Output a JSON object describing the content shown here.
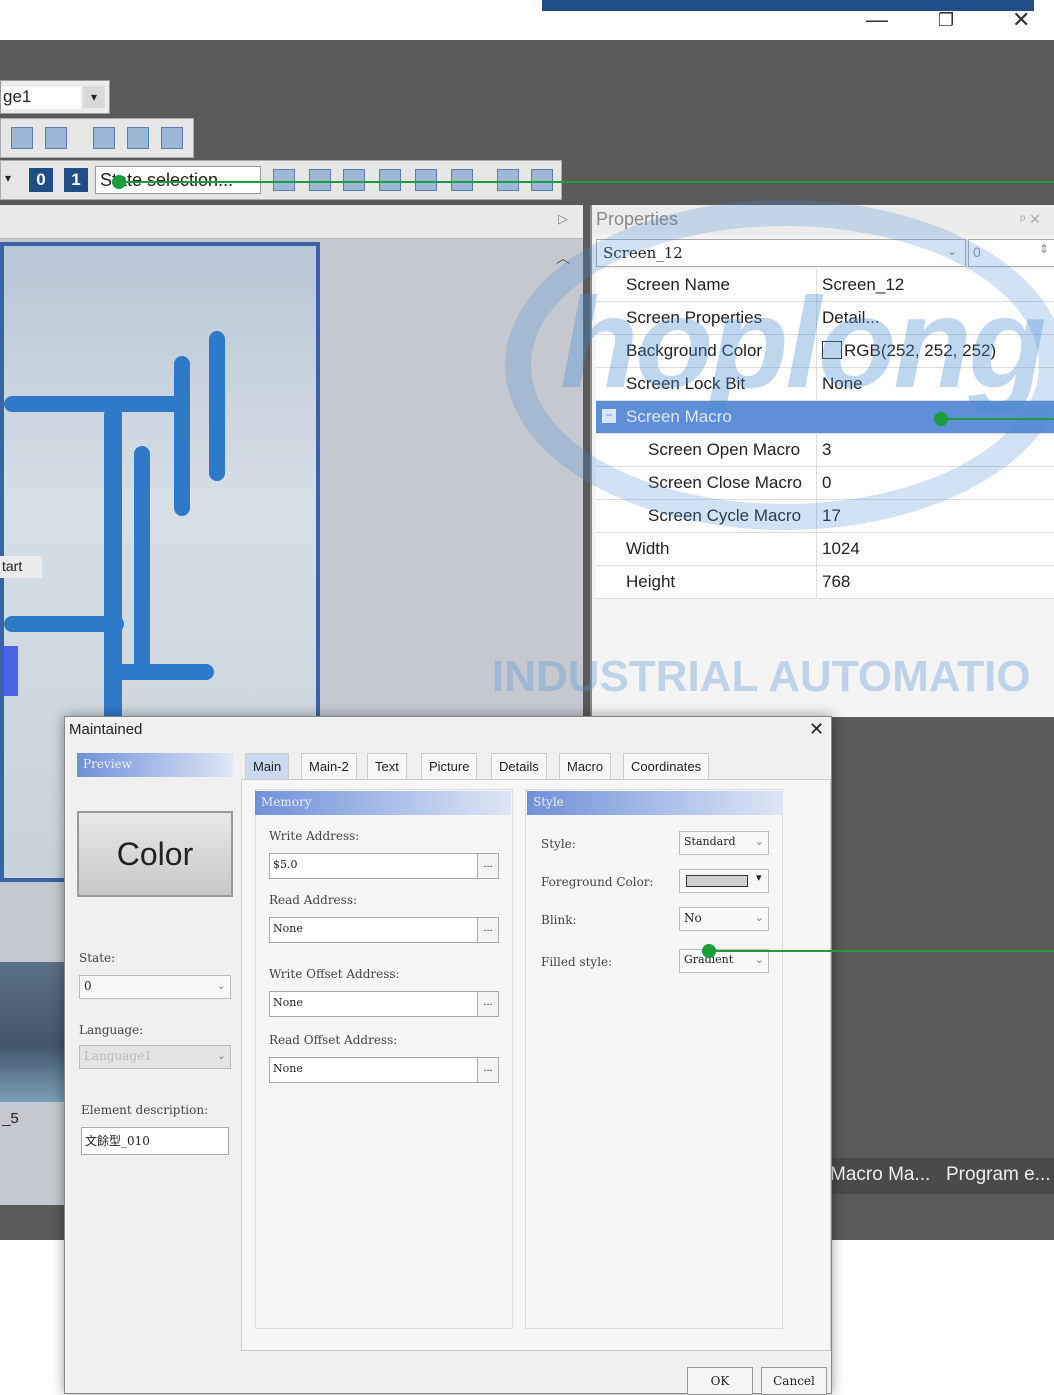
{
  "window": {
    "minimize": "—",
    "restore": "❐",
    "close": "✕"
  },
  "page_combo": {
    "value": "ge1"
  },
  "toolbar": {
    "zero": "0",
    "one": "1",
    "state_selection": "State selection..."
  },
  "canvas": {
    "start_label": "tart",
    "element_label": "_5"
  },
  "properties": {
    "title": "Properties",
    "pin_close": "ᵖ ✕",
    "object": "Screen_12",
    "field2": "0",
    "rows": [
      {
        "name": "Screen Name",
        "value": "Screen_12"
      },
      {
        "name": "Screen Properties",
        "value": "Detail..."
      },
      {
        "name": "Background Color",
        "value": "RGB(252, 252, 252)"
      },
      {
        "name": "Screen Lock Bit",
        "value": "None"
      },
      {
        "name": "Screen Macro",
        "value": ""
      },
      {
        "name": "Screen Open Macro",
        "value": "3"
      },
      {
        "name": "Screen Close Macro",
        "value": "0"
      },
      {
        "name": "Screen Cycle Macro",
        "value": "17"
      },
      {
        "name": "Width",
        "value": "1024"
      },
      {
        "name": "Height",
        "value": "768"
      }
    ]
  },
  "watermark": {
    "brand": "hoplong",
    "tagline": "INDUSTRIAL AUTOMATIO"
  },
  "bottom_tabs": [
    "Macro Ma...",
    "Program e..."
  ],
  "dialog": {
    "title": "Maintained",
    "close": "✕",
    "preview_header": "Preview",
    "preview_text": "Color",
    "state_label": "State:",
    "state_value": "0",
    "language_label": "Language:",
    "language_value": "Language1",
    "desc_label": "Element description:",
    "desc_value": "文餘型_010",
    "tabs": [
      "Main",
      "Main-2",
      "Text",
      "Picture",
      "Details",
      "Macro",
      "Coordinates"
    ],
    "memory": {
      "header": "Memory",
      "write_address_label": "Write Address:",
      "write_address": "$5.0",
      "read_address_label": "Read Address:",
      "read_address": "None",
      "write_offset_label": "Write Offset Address:",
      "write_offset": "None",
      "read_offset_label": "Read Offset Address:",
      "read_offset": "None",
      "browse": "..."
    },
    "style": {
      "header": "Style",
      "style_label": "Style:",
      "style_value": "Standard",
      "fg_label": "Foreground Color:",
      "blink_label": "Blink:",
      "blink_value": "No",
      "filled_label": "Filled style:",
      "filled_value": "Gradient"
    },
    "ok": "OK",
    "cancel": "Cancel"
  },
  "colors": {
    "accent": "#1f4e86",
    "callout_line": "#1a9e3a",
    "group_row": "#5f8fd6"
  }
}
